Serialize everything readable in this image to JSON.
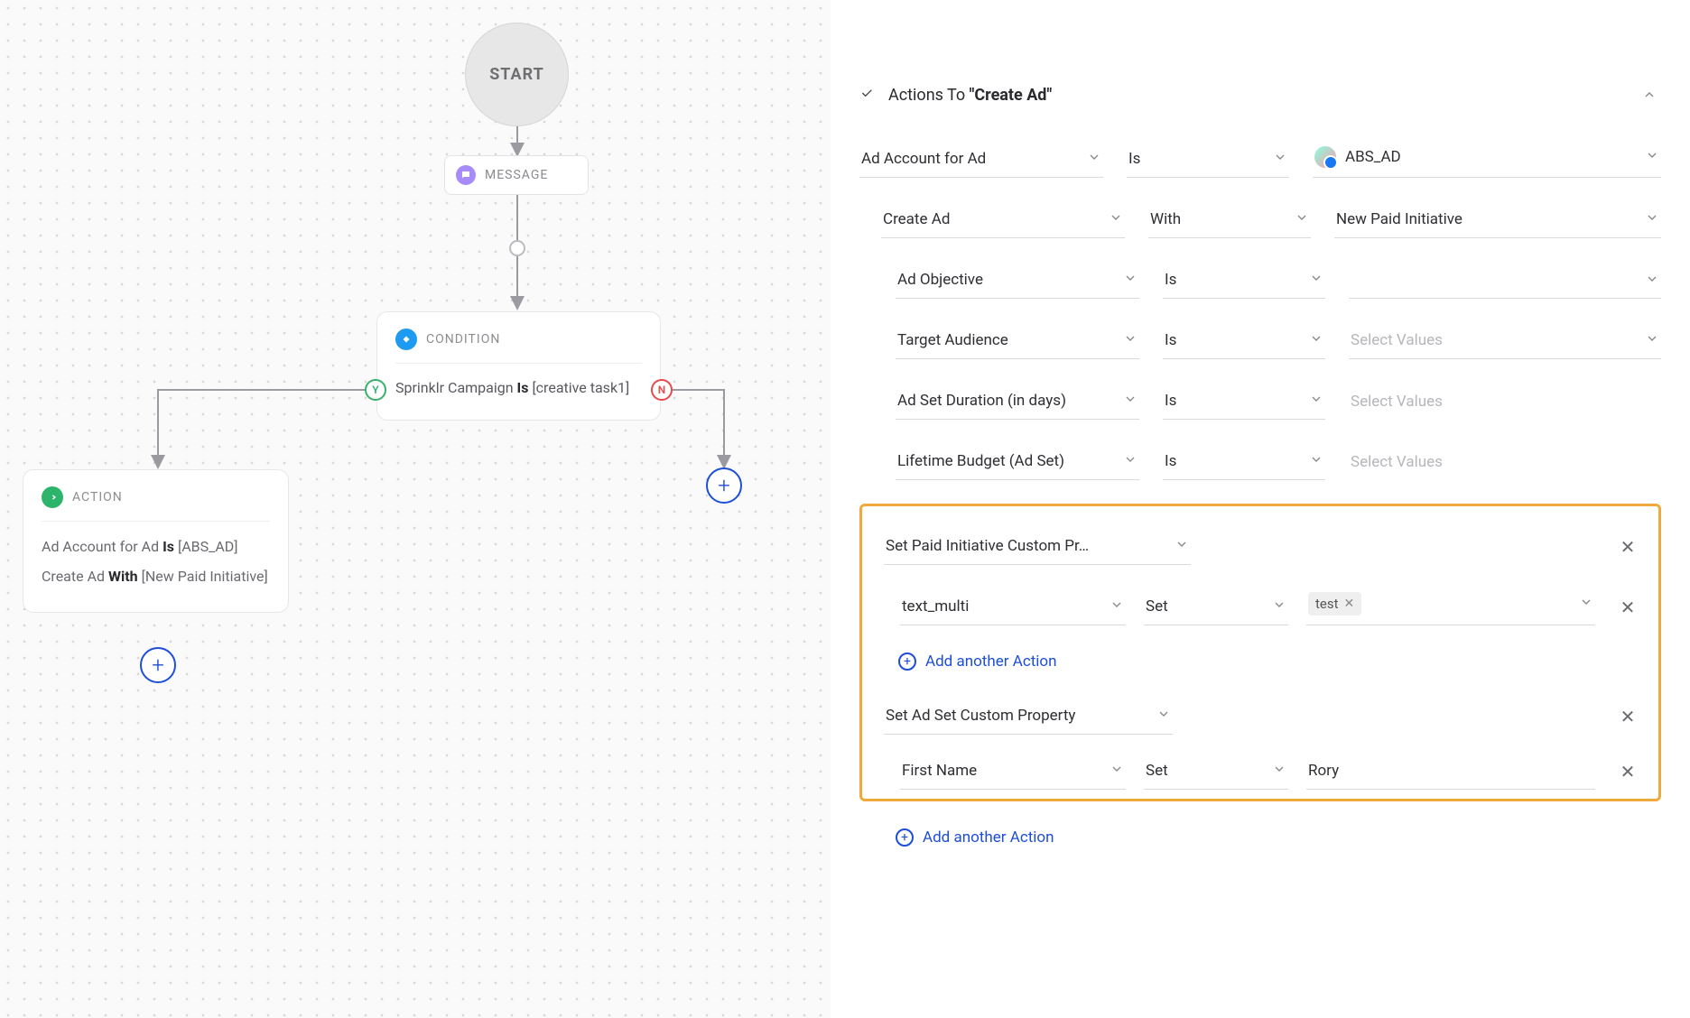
{
  "canvas": {
    "start": "START",
    "message": "MESSAGE",
    "condition": {
      "title": "CONDITION",
      "field": "Sprinklr Campaign",
      "op": "Is",
      "value": "[creative task1]"
    },
    "yes": "Y",
    "no": "N",
    "action": {
      "title": "ACTION",
      "line1_field": "Ad Account for Ad",
      "line1_op": "Is",
      "line1_val": "[ABS_AD]",
      "line2_field": "Create Ad",
      "line2_op": "With",
      "line2_val": "[New Paid Initiative]"
    }
  },
  "panel": {
    "title_prefix": "Actions To ",
    "title_quoted": "\"Create Ad\"",
    "rows": [
      {
        "field": "Ad Account for Ad",
        "op": "Is",
        "value": "ABS_AD",
        "avatar": true
      },
      {
        "field": "Create Ad",
        "op": "With",
        "value": "New Paid Initiative"
      },
      {
        "field": "Ad Objective",
        "op": "Is",
        "value": ""
      },
      {
        "field": "Target Audience",
        "op": "Is",
        "value": "",
        "placeholder": "Select Values"
      },
      {
        "field": "Ad Set Duration (in days)",
        "op": "Is",
        "value": "",
        "placeholder": "Select Values"
      },
      {
        "field": "Lifetime Budget (Ad Set)",
        "op": "Is",
        "value": "",
        "placeholder": "Select Values"
      }
    ],
    "highlight": {
      "group1": {
        "header": "Set Paid Initiative Custom Pr…",
        "sub": {
          "field": "text_multi",
          "op": "Set",
          "tag": "test"
        },
        "add": "Add another Action"
      },
      "group2": {
        "header": "Set Ad Set Custom Property",
        "sub": {
          "field": "First Name",
          "op": "Set",
          "value": "Rory"
        }
      }
    },
    "add_outer": "Add another Action"
  }
}
